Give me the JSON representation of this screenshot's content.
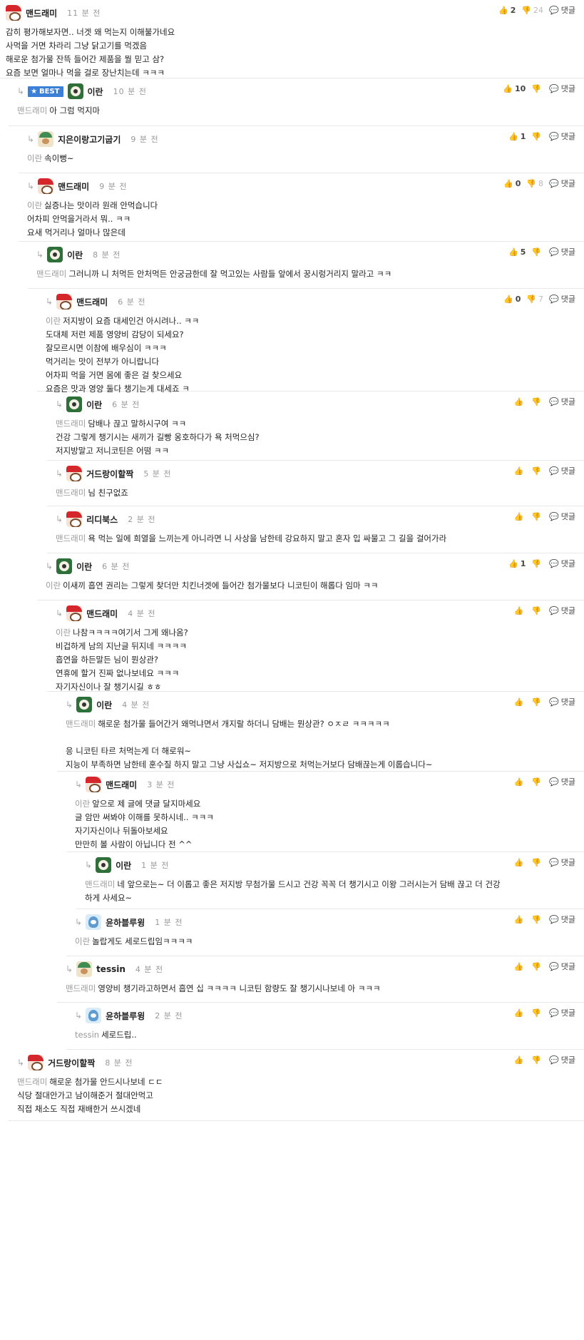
{
  "ui": {
    "reply_label": "댓글",
    "best_label": "BEST",
    "like_icon": "thumbs-up-icon",
    "dislike_icon": "thumbs-down-icon",
    "reply_icon": "speech-bubble-icon"
  },
  "comments": [
    {
      "id": "c1",
      "nick": "맨드래미",
      "time": "11 분 전",
      "likes": "2",
      "dislikes": "24",
      "reply_to": "",
      "lines": [
        "감히 평가해보자면.. 너겟 왜 먹는지 이해불가네요",
        "사먹을 거면 차라리 그냥 닭고기를 먹겠음",
        "해로운 첨가물 잔뜩 들어간 제품을 뭘 믿고 삼?",
        "요즘 보면 얼마나 먹을 걸로 장난치는데 ㅋㅋㅋ"
      ]
    },
    {
      "id": "c2",
      "nick": "이란",
      "time": "10 분 전",
      "likes": "10",
      "dislikes": "",
      "reply_to": "맨드래미",
      "lines": [
        "아 그럼 먹지마"
      ],
      "best": true
    },
    {
      "id": "c3",
      "nick": "지은이랑고기굽기",
      "time": "9 분 전",
      "likes": "1",
      "dislikes": "",
      "reply_to": "이란",
      "lines": [
        "속이뻥~"
      ]
    },
    {
      "id": "c4",
      "nick": "맨드래미",
      "time": "9 분 전",
      "likes": "0",
      "dislikes": "8",
      "reply_to": "이란",
      "lines": [
        "싫증나는 맛이라 원래 안먹습니다",
        "어차피 안먹을거라서 뭐.. ㅋㅋ",
        "요새 먹거리나 얼마나 많은데"
      ]
    },
    {
      "id": "c5",
      "nick": "이란",
      "time": "8 분 전",
      "likes": "5",
      "dislikes": "",
      "reply_to": "맨드래미",
      "lines": [
        "그러니까 니 처먹든 안처먹든 안궁금한데 잘 먹고있는 사람들 앞에서 꿍시렁거리지 말라고 ㅋㅋ"
      ]
    },
    {
      "id": "c6",
      "nick": "맨드래미",
      "time": "6 분 전",
      "likes": "0",
      "dislikes": "7",
      "reply_to": "이란",
      "lines": [
        "저지방이 요즘 대세인건 아시려나.. ㅋㅋ",
        "도대체 저런 제품 영양비 감당이 되세요?",
        "잘모르시면 이참에 배우심이 ㅋㅋㅋ",
        "먹거리는 맛이 전부가 아니랍니다",
        "어차피 먹을 거면 몸에 좋은 걸 찾으세요",
        "요즘은 맛과 영양 둘다 챙기는게 대세죠 ㅋ"
      ]
    },
    {
      "id": "c7",
      "nick": "이란",
      "time": "6 분 전",
      "likes": "",
      "dislikes": "",
      "reply_to": "맨드래미",
      "lines": [
        "담배나 끊고 말하시구여 ㅋㅋ",
        "건강 그렇게 챙기시는 새끼가 길빵 옹호하다가 욕 처먹으심?",
        "저지방말고 저니코틴은 어떰 ㅋㅋ"
      ]
    },
    {
      "id": "c8",
      "nick": "거드랑이할짝",
      "time": "5 분 전",
      "likes": "",
      "dislikes": "",
      "reply_to": "맨드래미",
      "lines": [
        "님 친구없죠"
      ]
    },
    {
      "id": "c9",
      "nick": "리디북스",
      "time": "2 분 전",
      "likes": "",
      "dislikes": "",
      "reply_to": "맨드래미",
      "lines": [
        "욕 먹는 일에 희열을 느끼는게 아니라면 니 사상을 남한테 강요하지 말고 혼자 입 싸물고 그 길을 걸어가라"
      ]
    },
    {
      "id": "c10",
      "nick": "이란",
      "time": "6 분 전",
      "likes": "1",
      "dislikes": "",
      "reply_to": "이란",
      "lines": [
        "이새끼 흡연 권리는 그렇게 찾더만 치킨너겟에 들어간 첨가물보다 니코틴이 해롭다 임마 ㅋㅋ"
      ]
    },
    {
      "id": "c11",
      "nick": "맨드래미",
      "time": "4 분 전",
      "likes": "",
      "dislikes": "",
      "reply_to": "이란",
      "lines": [
        "나참ㅋㅋㅋㅋ여기서 그게 왜나옴?",
        "비겁하게 남의 지난글 뒤지네 ㅋㅋㅋㅋ",
        "흡연을 하든말든 님이 뭔상관?",
        "연휴에 할거 진짜 없나보네요 ㅋㅋㅋ",
        "자기자신이나 잘 챙기시길 ㅎㅎ"
      ]
    },
    {
      "id": "c12",
      "nick": "이란",
      "time": "4 분 전",
      "likes": "",
      "dislikes": "",
      "reply_to": "맨드래미",
      "lines": [
        "해로운 첨가물 들어간거 왜먹냐면서 개지랄 하더니 담배는 뭔상관? ㅇㅈㄹ ㅋㅋㅋㅋㅋ",
        "",
        "응 니코틴 타르 처먹는게 더 해로워~",
        "지능이 부족하면 남한테 훈수질 하지 말고 그냥 사십쇼~ 저지방으로 처먹는거보다 담배끊는게 이롭습니다~"
      ]
    },
    {
      "id": "c13",
      "nick": "맨드래미",
      "time": "3 분 전",
      "likes": "",
      "dislikes": "",
      "reply_to": "이란",
      "lines": [
        "앞으로 제 글에 댓글 달지마세요",
        "글 암만 써봐야 이해를 못하시네.. ㅋㅋㅋ",
        "자기자신이나 뒤돌아보세요",
        "만만히 볼 사람이 아닙니다 전 ^^"
      ]
    },
    {
      "id": "c14",
      "nick": "이란",
      "time": "1 분 전",
      "likes": "",
      "dislikes": "",
      "reply_to": "맨드래미",
      "lines": [
        "네 앞으로는~ 더 이롭고 좋은 저지방 무첨가물 드시고 건강 꼭꼭 더 챙기시고 이왕 그러시는거 담배 끊고 더 건강",
        "하게 사세요~"
      ]
    },
    {
      "id": "c15",
      "nick": "윤하블루윙",
      "time": "1 분 전",
      "likes": "",
      "dislikes": "",
      "reply_to": "이란",
      "lines": [
        "놀랍게도 세로드립임ㅋㅋㅋㅋ"
      ]
    },
    {
      "id": "c16",
      "nick": "tessin",
      "time": "4 분 전",
      "likes": "",
      "dislikes": "",
      "reply_to": "맨드래미",
      "lines": [
        "영양비 챙기라고하면서 흡연 십 ㅋㅋㅋㅋ 니코틴 함량도 잘 챙기시나보네 아 ㅋㅋㅋ"
      ]
    },
    {
      "id": "c17",
      "nick": "윤하블루윙",
      "time": "2 분 전",
      "likes": "",
      "dislikes": "",
      "reply_to": "tessin",
      "lines": [
        "세로드립.."
      ]
    },
    {
      "id": "c18",
      "nick": "거드랑이할짝",
      "time": "8 분 전",
      "likes": "",
      "dislikes": "",
      "reply_to": "맨드래미",
      "lines": [
        "해로운 첨가물 안드시나보네 ㄷㄷ",
        "식당 절대안가고 남이해준거 절대안먹고",
        "직접 채소도 직접 재배한거 쓰시겠네"
      ]
    }
  ]
}
